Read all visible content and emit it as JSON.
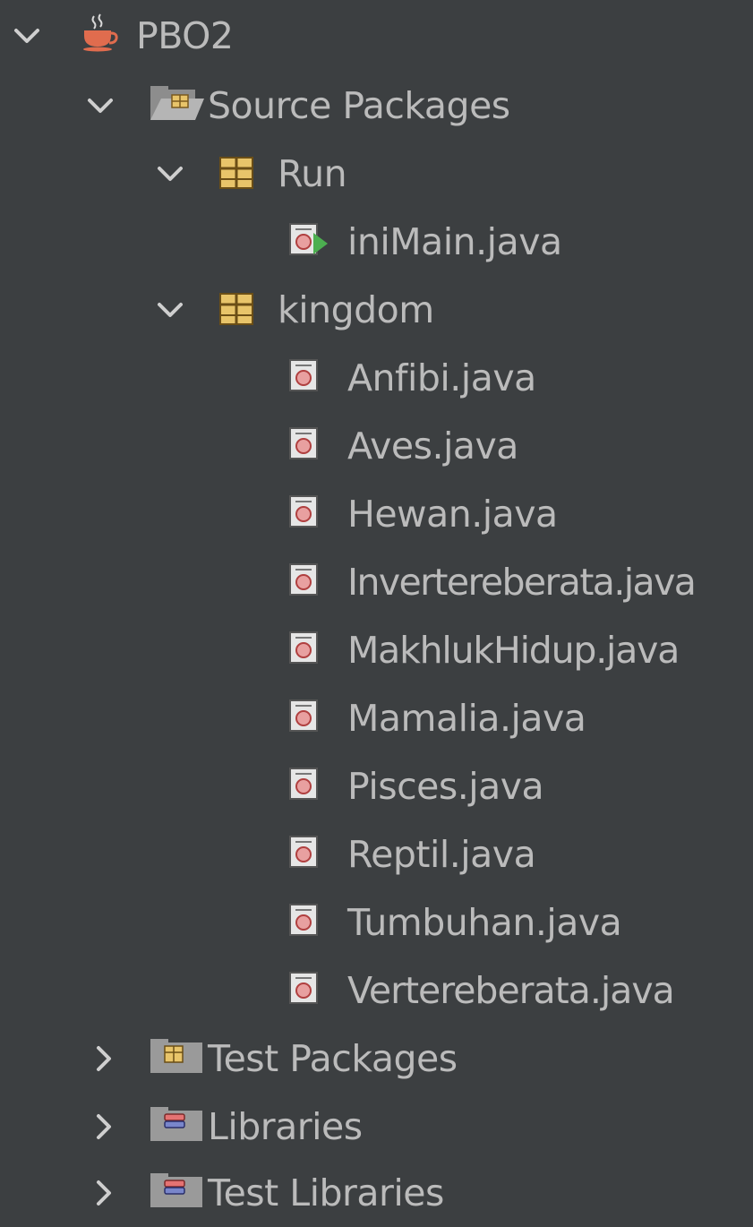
{
  "project": {
    "name": "PBO2",
    "icon": "java-coffee-cup-icon"
  },
  "source_packages": {
    "label": "Source Packages",
    "icon": "source-packages-folder-icon",
    "expanded": true,
    "packages": [
      {
        "name": "Run",
        "icon": "package-icon",
        "expanded": true,
        "files": [
          {
            "name": "iniMain.java",
            "icon": "java-main-class-icon"
          }
        ]
      },
      {
        "name": "kingdom",
        "icon": "package-icon",
        "expanded": true,
        "files": [
          {
            "name": "Anfibi.java",
            "icon": "java-class-file-icon"
          },
          {
            "name": "Aves.java",
            "icon": "java-class-file-icon"
          },
          {
            "name": "Hewan.java",
            "icon": "java-class-file-icon"
          },
          {
            "name": "Invertereberata.java",
            "icon": "java-class-file-icon"
          },
          {
            "name": "MakhlukHidup.java",
            "icon": "java-class-file-icon"
          },
          {
            "name": "Mamalia.java",
            "icon": "java-class-file-icon"
          },
          {
            "name": "Pisces.java",
            "icon": "java-class-file-icon"
          },
          {
            "name": "Reptil.java",
            "icon": "java-class-file-icon"
          },
          {
            "name": "Tumbuhan.java",
            "icon": "java-class-file-icon"
          },
          {
            "name": "Vertereberata.java",
            "icon": "java-class-file-icon"
          }
        ]
      }
    ]
  },
  "collapsed_nodes": [
    {
      "label": "Test Packages",
      "icon": "test-packages-folder-icon"
    },
    {
      "label": "Libraries",
      "icon": "libraries-folder-icon"
    },
    {
      "label": "Test Libraries",
      "icon": "test-libraries-folder-icon"
    }
  ],
  "colors": {
    "background": "#3c3f41",
    "text": "#bbbbbb",
    "package_yellow": "#e8c46a",
    "folder_gray": "#9a9a9a",
    "run_green": "#4caf50"
  }
}
